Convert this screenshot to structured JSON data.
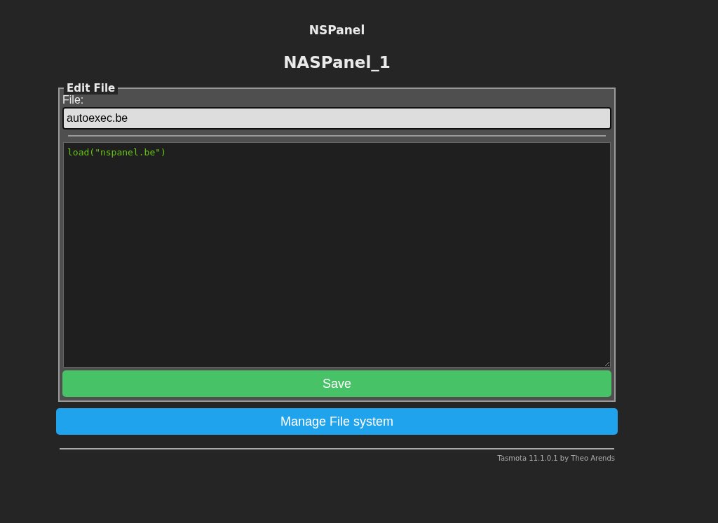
{
  "header": {
    "device_type": "NSPanel",
    "device_name": "NASPanel_1"
  },
  "edit_file": {
    "legend": "Edit File",
    "file_label": "File:",
    "file_value": "autoexec.be",
    "content": "load(\"nspanel.be\")",
    "save_button": "Save"
  },
  "manage_button": "Manage File system",
  "footer": "Tasmota 11.1.0.1 by Theo Arends"
}
